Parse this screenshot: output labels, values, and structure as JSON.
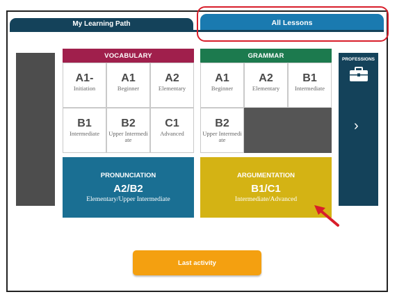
{
  "tabs": {
    "my_learning_path": "My Learning Path",
    "all_lessons": "All Lessons"
  },
  "vocabulary": {
    "title": "VOCABULARY",
    "cells": [
      {
        "level": "A1-",
        "desc": "Initiation"
      },
      {
        "level": "A1",
        "desc": "Beginner"
      },
      {
        "level": "A2",
        "desc": "Elementary"
      },
      {
        "level": "B1",
        "desc": "Intermediate"
      },
      {
        "level": "B2",
        "desc": "Upper Intermedi ate"
      },
      {
        "level": "C1",
        "desc": "Advanced"
      }
    ]
  },
  "grammar": {
    "title": "GRAMMAR",
    "cells": [
      {
        "level": "A1",
        "desc": "Beginner"
      },
      {
        "level": "A2",
        "desc": "Elementary"
      },
      {
        "level": "B1",
        "desc": "Intermediate"
      },
      {
        "level": "B2",
        "desc": "Upper Intermedi ate"
      }
    ]
  },
  "pronunciation": {
    "title": "PRONUNCIATION",
    "level": "A2/B2",
    "desc": "Elementary/Upper Intermediate"
  },
  "argumentation": {
    "title": "ARGUMENTATION",
    "level": "B1/C1",
    "desc": "Intermediate/Advanced"
  },
  "professions": {
    "title": "PROFESSIONS",
    "icon": "briefcase-icon",
    "next_icon": "chevron-right-icon"
  },
  "last_activity": "Last activity",
  "colors": {
    "vocabulary": "#a01f4c",
    "grammar": "#1c7a4e",
    "pronunciation": "#1a6f93",
    "argumentation": "#d4b314",
    "navy": "#14425a",
    "tab_active": "#1a7ab0",
    "button": "#f4a010",
    "annotation": "#d81e2a"
  }
}
